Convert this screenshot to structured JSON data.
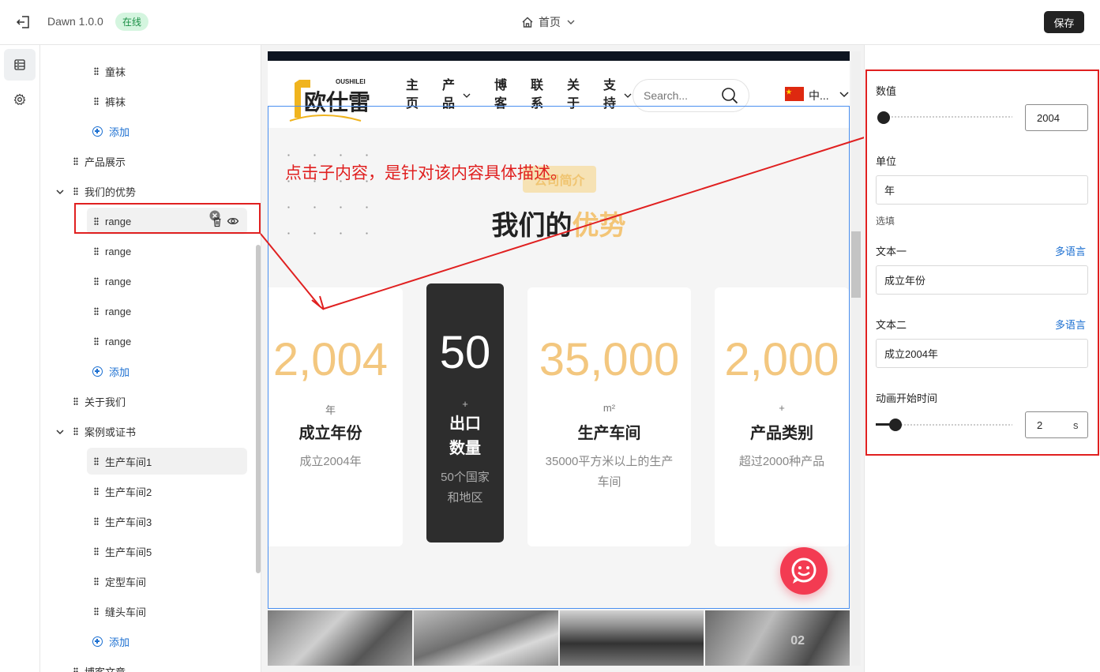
{
  "topbar": {
    "app_name": "Dawn 1.0.0",
    "status_badge": "在线",
    "page_name": "首页",
    "save_label": "保存"
  },
  "tree": {
    "items": [
      {
        "label": "童袜"
      },
      {
        "label": "裤袜"
      },
      {
        "label": "添加"
      },
      {
        "label": "产品展示"
      },
      {
        "label": "我们的优势"
      },
      {
        "label": "range"
      },
      {
        "label": "range"
      },
      {
        "label": "range"
      },
      {
        "label": "range"
      },
      {
        "label": "range"
      },
      {
        "label": "添加"
      },
      {
        "label": "关于我们"
      },
      {
        "label": "案例或证书"
      },
      {
        "label": "生产车间1"
      },
      {
        "label": "生产车间2"
      },
      {
        "label": "生产车间3"
      },
      {
        "label": "生产车间5"
      },
      {
        "label": "定型车间"
      },
      {
        "label": "缝头车间"
      },
      {
        "label": "添加"
      },
      {
        "label": "博客文章"
      }
    ]
  },
  "site": {
    "logo_text": "欧仕雷",
    "logo_small": "OUSHILEI",
    "nav": [
      "主页",
      "产品",
      "博客",
      "联系",
      "关于",
      "支持"
    ],
    "search_placeholder": "Search...",
    "lang": "中...",
    "tag": "公司简介",
    "title_main": "我们的",
    "title_accent": "优势",
    "annotation": "点击子内容，是针对该内容具体描述。",
    "cards": [
      {
        "num": "2,004",
        "unit": "年",
        "label": "成立年份",
        "desc": "成立2004年"
      },
      {
        "num": "50",
        "unit": "+",
        "label": "出口数量",
        "desc": "50个国家和地区"
      },
      {
        "num": "35,000",
        "unit": "m²",
        "label": "生产车间",
        "desc": "35000平方米以上的生产车间"
      },
      {
        "num": "2,000",
        "unit": "+",
        "label": "产品类别",
        "desc": "超过2000种产品"
      }
    ],
    "photo_number": "02"
  },
  "panel": {
    "value_label": "数值",
    "value": "2004",
    "value_slider_fraction": 0.0,
    "unit_label": "单位",
    "unit_value": "年",
    "unit_help": "选填",
    "text1_label": "文本一",
    "text1_value": "成立年份",
    "text2_label": "文本二",
    "text2_value": "成立2004年",
    "multilang": "多语言",
    "anim_label": "动画开始时间",
    "anim_value": "2",
    "anim_unit": "s"
  },
  "colors": {
    "accent_gold": "#f3c577",
    "annotation_red": "#e02020",
    "link_blue": "#1b6fd1",
    "chat_red": "#f33b52"
  }
}
